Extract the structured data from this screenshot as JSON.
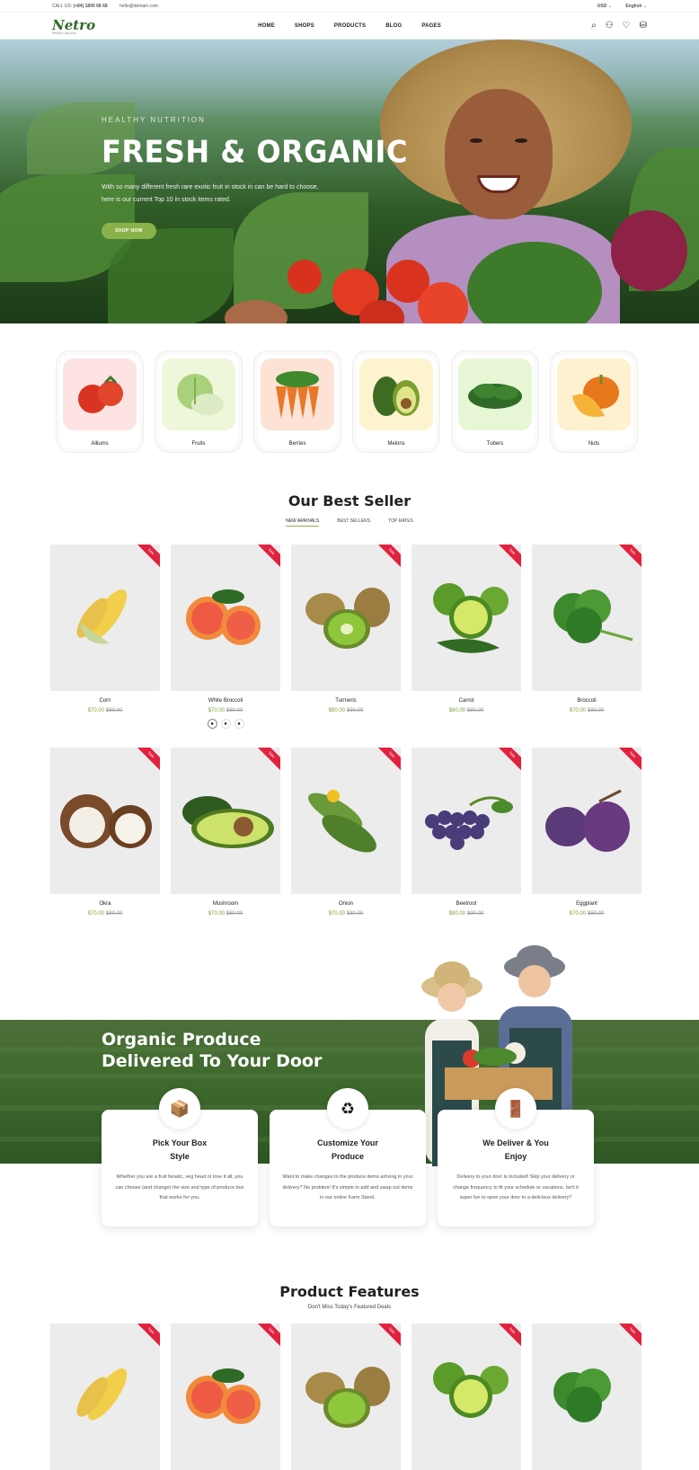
{
  "topbar": {
    "phone_label": "CALL US:",
    "phone": "(+84) 1800 68 68",
    "email": "hello@domain.com",
    "currency": "USD",
    "language": "English"
  },
  "header": {
    "logo": "Netro",
    "logo_tagline": "FRESH ORGANIC",
    "nav": [
      "HOME",
      "SHOPS",
      "PRODUCTS",
      "BLOG",
      "PAGES"
    ]
  },
  "hero": {
    "eyebrow": "HEALTHY NUTRITION",
    "title": "FRESH & ORGANIC",
    "text": "With so many different fresh rare exotic fruit in stock in can be hard to choose, here is our current Top 10 in stock items rated.",
    "button": "SHOP NOW"
  },
  "categories": [
    {
      "label": "Alliums",
      "bg": "#fde3e1"
    },
    {
      "label": "Fruits",
      "bg": "#eef7d9"
    },
    {
      "label": "Berries",
      "bg": "#fde2d6"
    },
    {
      "label": "Melons",
      "bg": "#fdf4cf"
    },
    {
      "label": "Tubers",
      "bg": "#e7f7d6"
    },
    {
      "label": "Nuts",
      "bg": "#fdf1cf"
    }
  ],
  "best_seller": {
    "title": "Our Best Seller",
    "tabs": [
      "NEW ARRIVALS",
      "BEST SELLERS",
      "TOP RATES"
    ],
    "ribbon": "Sale",
    "row1": [
      {
        "name": "Corn",
        "price": "$70.00",
        "old": "$80.00"
      },
      {
        "name": "White Broccoli",
        "price": "$70.00",
        "old": "$80.00"
      },
      {
        "name": "Turmeric",
        "price": "$80.00",
        "old": "$90.00"
      },
      {
        "name": "Carrot",
        "price": "$80.00",
        "old": "$90.00"
      },
      {
        "name": "Broccoli",
        "price": "$70.00",
        "old": "$80.00"
      }
    ],
    "row2": [
      {
        "name": "Okra",
        "price": "$70.00",
        "old": "$80.00"
      },
      {
        "name": "Mushroom",
        "price": "$70.00",
        "old": "$80.00"
      },
      {
        "name": "Onion",
        "price": "$70.00",
        "old": "$80.00"
      },
      {
        "name": "Beetroot",
        "price": "$80.00",
        "old": "$90.00"
      },
      {
        "name": "Eggplant",
        "price": "$70.00",
        "old": "$80.00"
      }
    ]
  },
  "delivery": {
    "title_line1": "Organic Produce",
    "title_line2": "Delivered To Your Door",
    "cards": [
      {
        "title": "Pick Your Box Style",
        "text": "Whether you are a fruit fanatic, veg head or love it all, you can choose (and change) the size and type of produce box that works for you."
      },
      {
        "title": "Customize Your Produce",
        "text": "Want to make changes to the produce items arriving in your delivery? No problem! It's simple to add and swap out items in our online Farm Stand."
      },
      {
        "title": "We Deliver & You Enjoy",
        "text": "Delivery to your door is included! Skip your delivery or change frequency to fit your schedule or vacations. Isn't it super fun to open your door to a delicious delivery?"
      }
    ]
  },
  "features": {
    "title": "Product Features",
    "subtitle": "Don't Miss Today's Featured Deals"
  }
}
